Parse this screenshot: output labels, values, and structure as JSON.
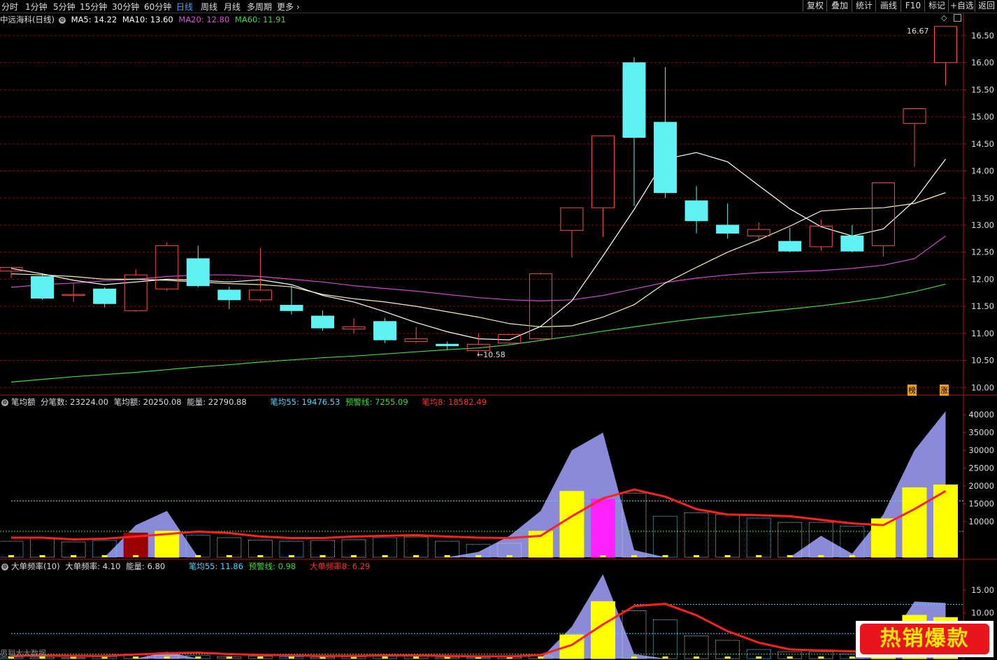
{
  "topbar": {
    "tabs": [
      {
        "label": "分时"
      },
      {
        "label": "1分钟"
      },
      {
        "label": "5分钟"
      },
      {
        "label": "15分钟"
      },
      {
        "label": "30分钟"
      },
      {
        "label": "60分钟"
      },
      {
        "label": "日线",
        "active": true
      },
      {
        "label": "周线"
      },
      {
        "label": "月线"
      },
      {
        "label": "多周期"
      },
      {
        "label": "更多"
      }
    ],
    "right_buttons": [
      {
        "label": "复权"
      },
      {
        "label": "叠加"
      },
      {
        "label": "统计"
      },
      {
        "label": "画线"
      },
      {
        "label": "F10"
      },
      {
        "label": "标记"
      },
      {
        "label": "+自选"
      },
      {
        "label": "返回"
      }
    ]
  },
  "main_legend": {
    "title": "中远海科(日线)",
    "items": [
      {
        "text": "MA5: 14.22",
        "color": "#ffffff"
      },
      {
        "text": "MA10: 13.60",
        "color": "#ffffff"
      },
      {
        "text": "MA20: 12.80",
        "color": "#e04ce0"
      },
      {
        "text": "MA60: 11.91",
        "color": "#3ddc3d"
      }
    ]
  },
  "panel2_legend": {
    "items": [
      {
        "text": "笔均额",
        "color": "#dddddd"
      },
      {
        "text": "分笔数: 23224.00",
        "color": "#dddddd"
      },
      {
        "text": "笔均额: 20250.08",
        "color": "#dddddd"
      },
      {
        "text": "能量: 22790.88",
        "color": "#dddddd"
      },
      {
        "text": "笔均55: 19476.53",
        "color": "#4fd7ff"
      },
      {
        "text": "预警线: 7255.09",
        "color": "#3ddc3d"
      },
      {
        "text": "笔均8: 18582.49",
        "color": "#ff3030"
      }
    ]
  },
  "panel3_legend": {
    "items": [
      {
        "text": "大单频率(10)",
        "color": "#dddddd"
      },
      {
        "text": "大单频率: 4.10",
        "color": "#dddddd"
      },
      {
        "text": "能量: 6.80",
        "color": "#dddddd"
      },
      {
        "text": "笔均55: 11.86",
        "color": "#4fd7ff"
      },
      {
        "text": "预警线: 0.98",
        "color": "#3ddc3d"
      },
      {
        "text": "大单频率8: 6.29",
        "color": "#ff3030"
      }
    ]
  },
  "annotations": {
    "high_label": "16.67",
    "low_label": "10.58",
    "corner_a": "榜",
    "corner_b": "涨",
    "bottom_left": "思到大大数据"
  },
  "badge": {
    "text": "热销爆款"
  },
  "colors": {
    "up": "#ff4a4a",
    "down": "#5ff2f2",
    "ma5": "#ffffff",
    "ma10": "#f7f0b4",
    "ma20": "#d048d0",
    "ma60": "#3ddc3d",
    "grid": "#7a1010",
    "axis": "#b01818",
    "energy": "#8a8ad8",
    "yellow": "#ffff00",
    "magenta": "#ff22ff",
    "darkred": "#990000",
    "redline": "#ff2020"
  },
  "chart_data": [
    {
      "type": "candlestick",
      "title": "中远海科(日线)",
      "ylim": [
        9.9,
        16.9
      ],
      "yticks": [
        "10.00",
        "10.50",
        "11.00",
        "11.50",
        "12.00",
        "12.50",
        "13.00",
        "13.50",
        "14.00",
        "14.50",
        "15.00",
        "15.50",
        "16.00",
        "16.50"
      ],
      "candles": [
        {
          "o": 12.15,
          "h": 12.22,
          "l": 12.02,
          "c": 12.22
        },
        {
          "o": 12.05,
          "h": 12.08,
          "l": 11.62,
          "c": 11.65
        },
        {
          "o": 11.7,
          "h": 11.92,
          "l": 11.58,
          "c": 11.72
        },
        {
          "o": 11.82,
          "h": 11.85,
          "l": 11.48,
          "c": 11.55
        },
        {
          "o": 11.42,
          "h": 12.18,
          "l": 11.4,
          "c": 12.08
        },
        {
          "o": 11.82,
          "h": 12.68,
          "l": 11.78,
          "c": 12.62
        },
        {
          "o": 12.38,
          "h": 12.62,
          "l": 11.85,
          "c": 11.88
        },
        {
          "o": 11.8,
          "h": 11.86,
          "l": 11.45,
          "c": 11.62
        },
        {
          "o": 11.62,
          "h": 12.58,
          "l": 11.58,
          "c": 11.8
        },
        {
          "o": 11.52,
          "h": 11.88,
          "l": 11.35,
          "c": 11.42
        },
        {
          "o": 11.32,
          "h": 11.42,
          "l": 11.05,
          "c": 11.1
        },
        {
          "o": 11.08,
          "h": 11.28,
          "l": 11.0,
          "c": 11.12
        },
        {
          "o": 11.22,
          "h": 11.28,
          "l": 10.82,
          "c": 10.88
        },
        {
          "o": 10.85,
          "h": 11.12,
          "l": 10.82,
          "c": 10.9
        },
        {
          "o": 10.8,
          "h": 10.85,
          "l": 10.7,
          "c": 10.77
        },
        {
          "o": 10.68,
          "h": 11.0,
          "l": 10.58,
          "c": 10.8
        },
        {
          "o": 10.82,
          "h": 10.98,
          "l": 10.8,
          "c": 10.98
        },
        {
          "o": 10.9,
          "h": 12.12,
          "l": 10.88,
          "c": 12.1
        },
        {
          "o": 12.9,
          "h": 13.32,
          "l": 12.4,
          "c": 13.32
        },
        {
          "o": 13.32,
          "h": 14.65,
          "l": 12.78,
          "c": 14.65
        },
        {
          "o": 16.0,
          "h": 16.1,
          "l": 13.35,
          "c": 14.62
        },
        {
          "o": 14.9,
          "h": 15.92,
          "l": 13.5,
          "c": 13.6
        },
        {
          "o": 13.45,
          "h": 13.72,
          "l": 12.85,
          "c": 13.08
        },
        {
          "o": 13.0,
          "h": 13.4,
          "l": 12.75,
          "c": 12.85
        },
        {
          "o": 12.8,
          "h": 13.05,
          "l": 12.7,
          "c": 12.92
        },
        {
          "o": 12.7,
          "h": 12.95,
          "l": 12.5,
          "c": 12.52
        },
        {
          "o": 12.6,
          "h": 13.1,
          "l": 12.52,
          "c": 12.98
        },
        {
          "o": 12.8,
          "h": 13.0,
          "l": 12.5,
          "c": 12.52
        },
        {
          "o": 12.62,
          "h": 13.78,
          "l": 12.42,
          "c": 13.78
        },
        {
          "o": 14.88,
          "h": 15.15,
          "l": 14.08,
          "c": 15.15
        },
        {
          "o": 16.0,
          "h": 16.67,
          "l": 15.58,
          "c": 16.67
        }
      ],
      "ma5": [
        12.2,
        12.1,
        11.98,
        11.9,
        11.95,
        12.0,
        11.98,
        11.95,
        11.99,
        11.9,
        11.7,
        11.58,
        11.4,
        11.2,
        11.03,
        10.9,
        10.88,
        11.13,
        11.6,
        12.43,
        13.29,
        14.22,
        14.34,
        14.17,
        13.73,
        13.3,
        12.97,
        12.8,
        12.93,
        13.45,
        14.22
      ],
      "ma10": [
        12.1,
        12.08,
        12.05,
        12.0,
        12.0,
        11.98,
        11.95,
        11.92,
        11.9,
        11.86,
        11.72,
        11.64,
        11.58,
        11.5,
        11.4,
        11.3,
        11.18,
        11.12,
        11.14,
        11.3,
        11.53,
        11.93,
        12.22,
        12.5,
        12.73,
        12.98,
        13.26,
        13.3,
        13.32,
        13.4,
        13.6
      ],
      "ma20": [
        11.85,
        11.9,
        11.93,
        11.97,
        12.0,
        12.05,
        12.08,
        12.08,
        12.05,
        12.0,
        11.95,
        11.88,
        11.83,
        11.78,
        11.72,
        11.66,
        11.62,
        11.6,
        11.62,
        11.7,
        11.82,
        11.94,
        12.02,
        12.08,
        12.12,
        12.14,
        12.16,
        12.2,
        12.26,
        12.38,
        12.8
      ],
      "ma60": [
        10.1,
        10.15,
        10.2,
        10.24,
        10.28,
        10.33,
        10.38,
        10.42,
        10.47,
        10.51,
        10.55,
        10.58,
        10.62,
        10.66,
        10.7,
        10.73,
        10.79,
        10.87,
        10.95,
        11.04,
        11.12,
        11.2,
        11.27,
        11.33,
        11.39,
        11.45,
        11.51,
        11.58,
        11.66,
        11.77,
        11.91
      ]
    },
    {
      "type": "bar",
      "title": "笔均额",
      "ylim": [
        0,
        42000
      ],
      "yticks": [
        "10000",
        "15000",
        "20000",
        "25000",
        "30000",
        "35000",
        "40000"
      ],
      "bars": [
        4500,
        5500,
        4300,
        4700,
        6800,
        7300,
        6200,
        5500,
        4800,
        4500,
        4700,
        4900,
        5500,
        5700,
        4500,
        3600,
        3900,
        7300,
        18500,
        16300,
        18000,
        11500,
        12500,
        12000,
        11000,
        9800,
        9800,
        8700,
        10800,
        19500,
        20300
      ],
      "bar_styles": [
        "o",
        "o",
        "o",
        "o",
        "d",
        "y",
        "o",
        "o",
        "o",
        "o",
        "o",
        "o",
        "o",
        "o",
        "o",
        "o",
        "o",
        "y",
        "y",
        "m",
        "o",
        "o",
        "o",
        "o",
        "o",
        "o",
        "o",
        "o",
        "y",
        "y",
        "y"
      ],
      "energy": [
        0,
        0,
        0,
        0,
        9000,
        13000,
        0,
        0,
        0,
        0,
        0,
        0,
        0,
        0,
        0,
        1500,
        6000,
        13000,
        30000,
        35000,
        2000,
        0,
        0,
        0,
        0,
        0,
        6000,
        1000,
        12000,
        30000,
        41000
      ],
      "line8": [
        5500,
        5500,
        5000,
        5200,
        5800,
        6500,
        7200,
        6800,
        5800,
        5400,
        5400,
        5800,
        6000,
        6200,
        5800,
        5500,
        5400,
        6000,
        11500,
        16500,
        19000,
        17000,
        13500,
        12000,
        11800,
        11500,
        10500,
        9500,
        9000,
        13500,
        18580
      ],
      "warn_line": 7255,
      "avg55_line": 15800,
      "avg55_right": 18200
    },
    {
      "type": "bar",
      "title": "大单频率(10)",
      "ylim": [
        0,
        19
      ],
      "yticks": [
        "10.00",
        "15.00"
      ],
      "bars": [
        0.3,
        0.3,
        0.2,
        0.4,
        1.0,
        0.7,
        0.7,
        0.4,
        0.5,
        0.4,
        0.3,
        0.4,
        0.5,
        0.5,
        0.3,
        0.2,
        0.3,
        0.6,
        5.2,
        12.5,
        10.5,
        8.5,
        5.0,
        4.0,
        2.0,
        1.5,
        1.5,
        1.0,
        1.5,
        9.5,
        9.0
      ],
      "bar_styles": [
        "o",
        "o",
        "o",
        "o",
        "o",
        "o",
        "o",
        "o",
        "o",
        "o",
        "o",
        "o",
        "o",
        "o",
        "o",
        "o",
        "o",
        "o",
        "y",
        "y",
        "o",
        "o",
        "o",
        "o",
        "o",
        "o",
        "o",
        "o",
        "y",
        "y",
        "y"
      ],
      "energy": [
        0,
        0,
        0,
        0,
        0,
        1.5,
        0,
        0,
        0,
        0,
        0,
        0,
        0,
        0,
        0,
        0,
        0,
        0,
        7.0,
        18.5,
        1.0,
        0,
        0,
        0,
        0,
        0,
        0,
        0,
        2.0,
        12.5,
        12.2
      ],
      "line8": [
        0.6,
        0.7,
        0.6,
        0.6,
        0.9,
        1.2,
        1.3,
        1.0,
        0.8,
        0.7,
        0.6,
        0.6,
        0.7,
        0.7,
        0.6,
        0.5,
        0.5,
        0.8,
        3.0,
        7.5,
        11.5,
        12.0,
        9.5,
        6.0,
        3.5,
        2.0,
        1.8,
        1.6,
        1.4,
        2.5,
        6.3
      ],
      "warn_line": 0.98,
      "avg55_line": 5.5,
      "upper_line": 11.9
    }
  ]
}
